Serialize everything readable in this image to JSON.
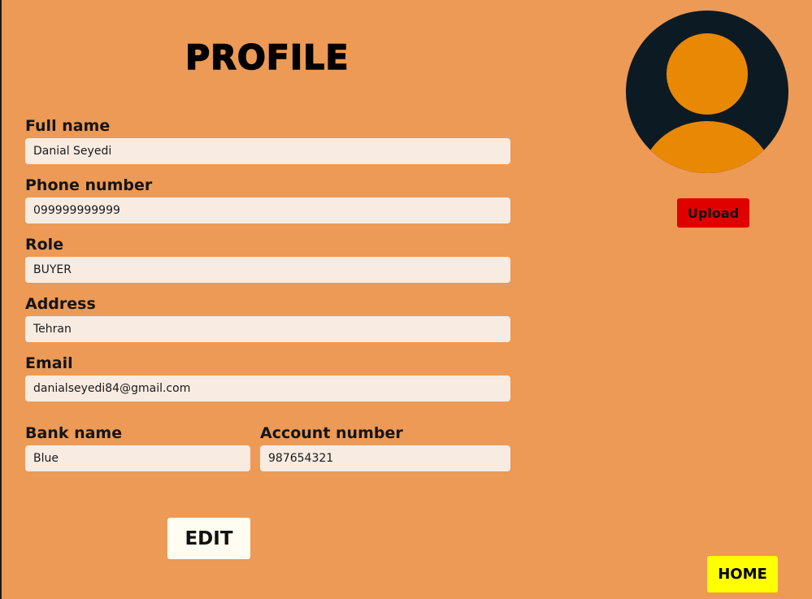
{
  "header": {
    "title": "PROFILE"
  },
  "form": {
    "full_name": {
      "label": "Full name",
      "value": "Danial Seyedi"
    },
    "phone": {
      "label": "Phone number",
      "value": "099999999999"
    },
    "role": {
      "label": "Role",
      "value": "BUYER"
    },
    "address": {
      "label": "Address",
      "value": "Tehran"
    },
    "email": {
      "label": "Email",
      "value": "danialseyedi84@gmail.com"
    },
    "bank_name": {
      "label": "Bank name",
      "value": "Blue"
    },
    "account_number": {
      "label": "Account number",
      "value": "987654321"
    }
  },
  "avatar": {
    "icon": "user-avatar-icon"
  },
  "actions": {
    "upload_label": "Upload",
    "edit_label": "EDIT",
    "home_label": "HOME"
  },
  "colors": {
    "background": "#ec9a55",
    "input_bg": "#f8ebe2",
    "avatar_bg": "#0c1a24",
    "avatar_fg": "#e88804",
    "upload_bg": "#e00000",
    "edit_bg": "#fffdf2",
    "home_bg": "#ffff00"
  }
}
